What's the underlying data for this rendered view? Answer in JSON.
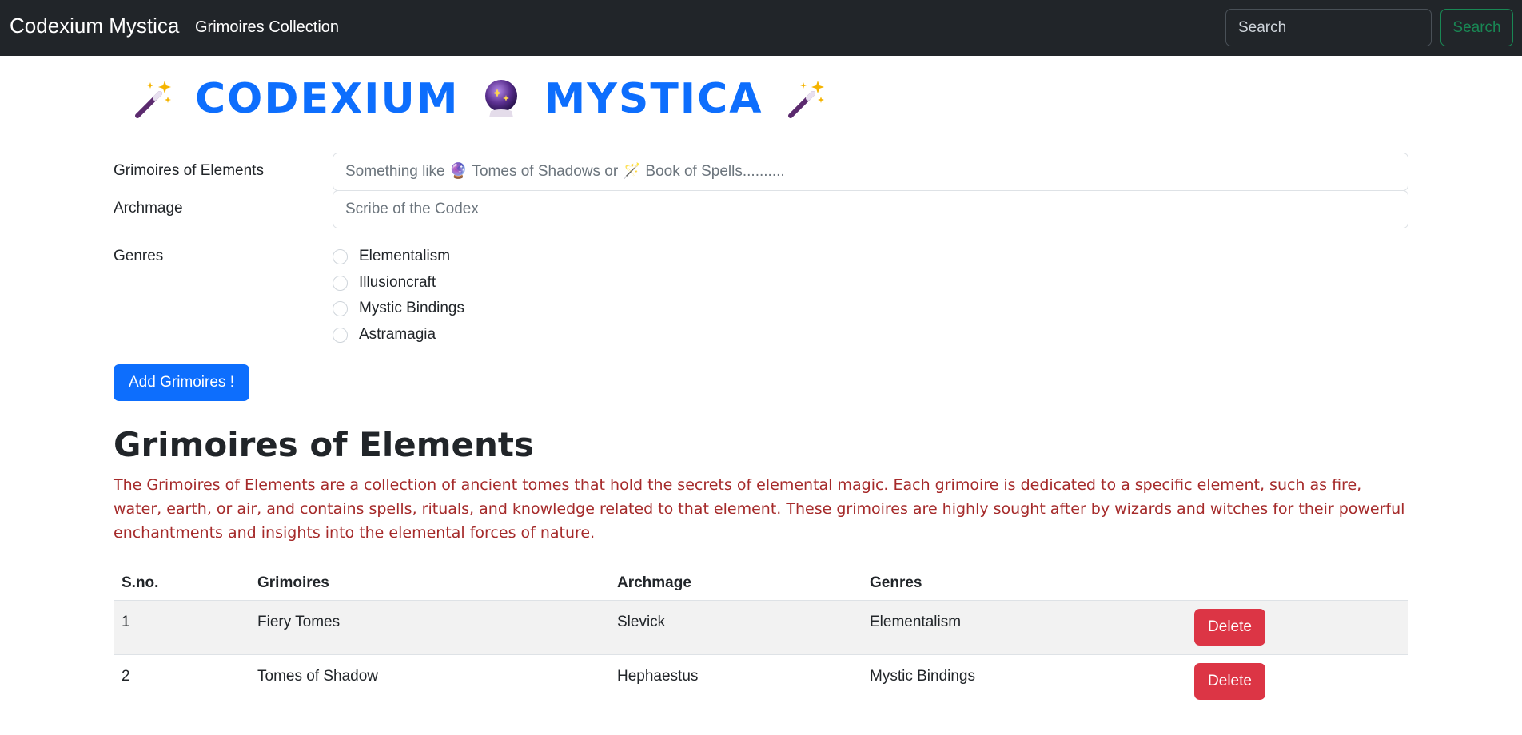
{
  "navbar": {
    "brand": "Codexium Mystica",
    "link": "Grimoires Collection",
    "search_placeholder": "Search",
    "search_button": "Search"
  },
  "hero": {
    "word1": "CODEXIUM",
    "word2": "MYSTICA",
    "icons": [
      "magic-wand-icon",
      "crystal-ball-icon",
      "magic-wand-icon"
    ]
  },
  "form": {
    "grimoire_label": "Grimoires of Elements",
    "grimoire_placeholder": "Something like 🔮 Tomes of Shadows or 🪄 Book of Spells..........",
    "archmage_label": "Archmage",
    "archmage_placeholder": "Scribe of the Codex",
    "genres_label": "Genres",
    "genres": [
      "Elementalism",
      "Illusioncraft",
      "Mystic Bindings",
      "Astramagia"
    ],
    "submit": "Add Grimoires !"
  },
  "section": {
    "title": "Grimoires of Elements",
    "description": "The Grimoires of Elements are a collection of ancient tomes that hold the secrets of elemental magic. Each grimoire is dedicated to a specific element, such as fire, water, earth, or air, and contains spells, rituals, and knowledge related to that element. These grimoires are highly sought after by wizards and witches for their powerful enchantments and insights into the elemental forces of nature."
  },
  "table": {
    "headers": [
      "S.no.",
      "Grimoires",
      "Archmage",
      "Genres"
    ],
    "rows": [
      {
        "sno": "1",
        "grimoire": "Fiery Tomes",
        "archmage": "Slevick",
        "genre": "Elementalism",
        "action": "Delete"
      },
      {
        "sno": "2",
        "grimoire": "Tomes of Shadow",
        "archmage": "Hephaestus",
        "genre": "Mystic Bindings",
        "action": "Delete"
      }
    ]
  },
  "colors": {
    "navbar_bg": "#212529",
    "primary": "#0d6efd",
    "danger": "#dc3545",
    "success": "#198754",
    "description_text": "#a52a2a"
  }
}
